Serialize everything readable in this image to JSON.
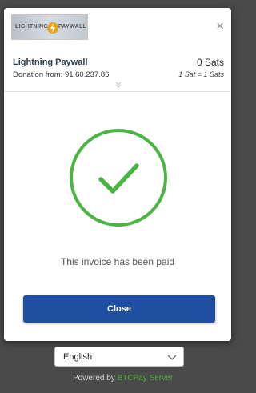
{
  "modal": {
    "logo": {
      "alt": "Lightning Paywall logo",
      "text_left": "LIGHTNING",
      "text_right": "PAYWALL"
    },
    "close_icon": "×",
    "item": {
      "title": "Lightning Paywall",
      "subtitle": "Donation from: 91.60.237.86",
      "total": "0 Sats",
      "rate": "1 Sat = 1 Sats"
    },
    "status_message": "This invoice has been paid",
    "close_button_label": "Close"
  },
  "footer": {
    "language": "English",
    "powered_prefix": "Powered by ",
    "powered_link": "BTCPay Server"
  },
  "colors": {
    "accent_blue": "#1e4fa0",
    "success_green": "#4bb543",
    "brand_green": "#51b13e"
  },
  "icons": {
    "close": "close-icon",
    "expand": "chevron-down-icon",
    "success": "check-circle-icon",
    "select": "chevron-down-icon"
  }
}
